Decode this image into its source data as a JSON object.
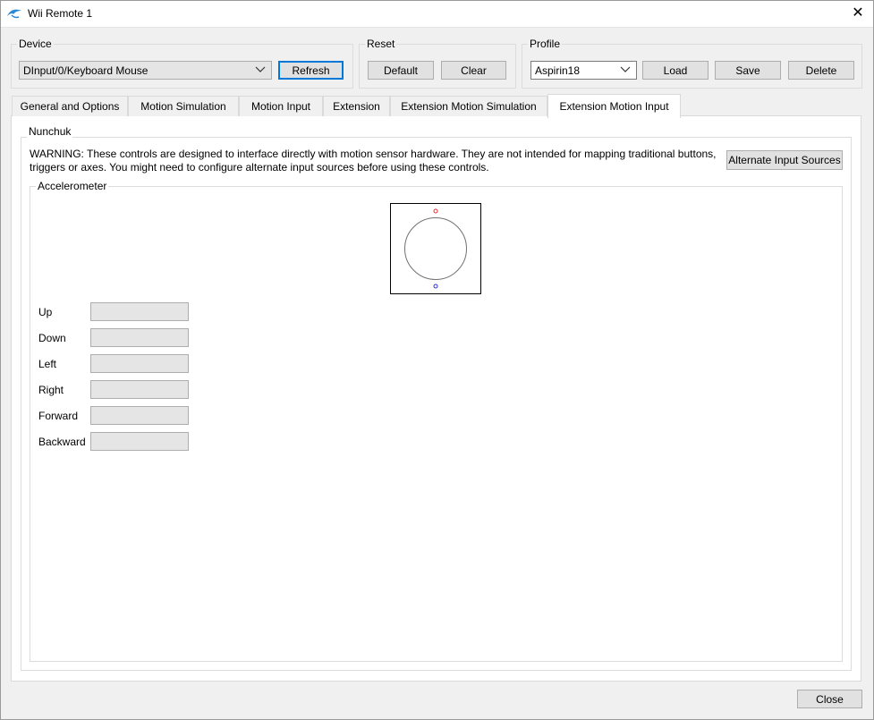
{
  "window": {
    "title": "Wii Remote 1"
  },
  "device": {
    "legend": "Device",
    "selected": "DInput/0/Keyboard Mouse",
    "refresh_label": "Refresh"
  },
  "reset": {
    "legend": "Reset",
    "default_label": "Default",
    "clear_label": "Clear"
  },
  "profile": {
    "legend": "Profile",
    "selected": "Aspirin18",
    "load_label": "Load",
    "save_label": "Save",
    "delete_label": "Delete"
  },
  "tabs": [
    {
      "label": "General and Options"
    },
    {
      "label": "Motion Simulation"
    },
    {
      "label": "Motion Input"
    },
    {
      "label": "Extension"
    },
    {
      "label": "Extension Motion Simulation"
    },
    {
      "label": "Extension Motion Input",
      "active": true
    }
  ],
  "nunchuk": {
    "legend": "Nunchuk",
    "warning_line1": "WARNING: These controls are designed to interface directly with motion sensor hardware. They are not intended for mapping traditional buttons,",
    "warning_line2": "triggers or axes. You might need to configure alternate input sources before using these controls.",
    "alternate_label": "Alternate Input Sources"
  },
  "accelerometer": {
    "legend": "Accelerometer",
    "fields": [
      {
        "label": "Up",
        "value": ""
      },
      {
        "label": "Down",
        "value": ""
      },
      {
        "label": "Left",
        "value": ""
      },
      {
        "label": "Right",
        "value": ""
      },
      {
        "label": "Forward",
        "value": ""
      },
      {
        "label": "Backward",
        "value": ""
      }
    ]
  },
  "footer": {
    "close_label": "Close"
  },
  "colors": {
    "dot_top": "#e03030",
    "dot_bottom": "#3030d0",
    "focus_accent": "#0078d7"
  }
}
